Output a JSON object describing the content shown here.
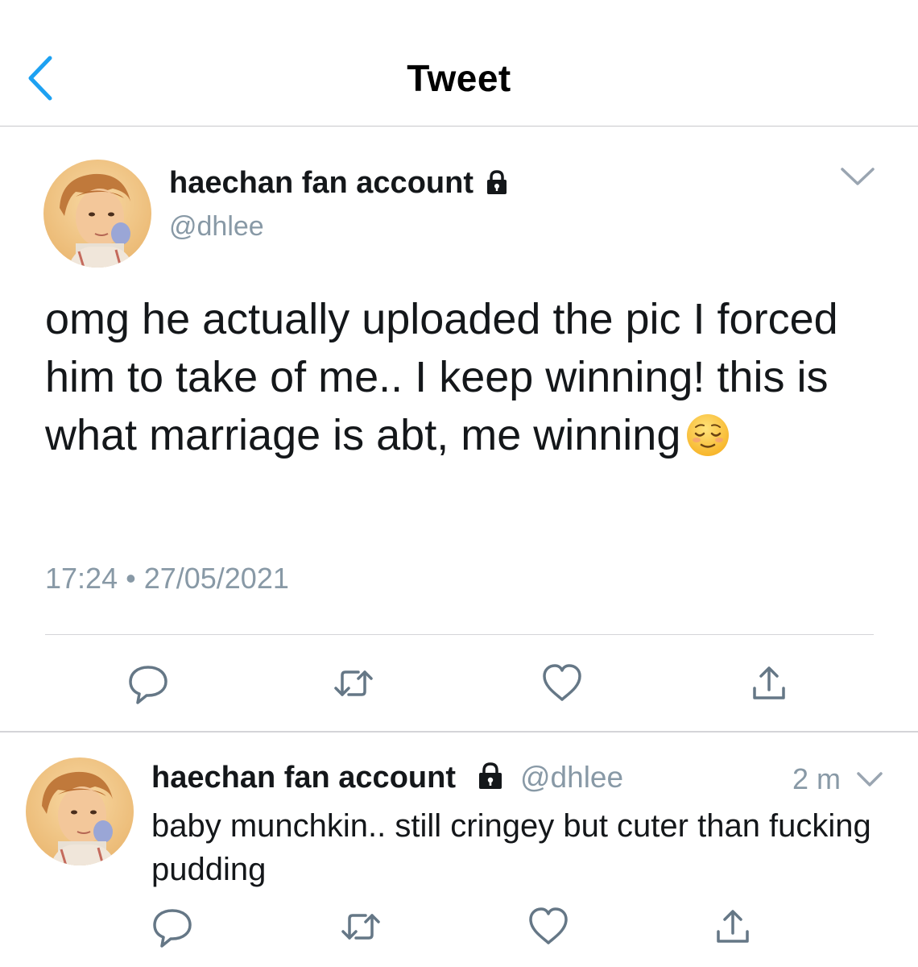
{
  "nav": {
    "title": "Tweet",
    "back_icon": "chevron-left-icon"
  },
  "colors": {
    "accent": "#1da1f2",
    "text_primary": "#14171a",
    "text_secondary": "#8899a6",
    "icon_gray": "#657786",
    "divider": "#d4d4d8"
  },
  "tweet": {
    "author_name": "haechan fan account",
    "author_handle": "@dhlee",
    "protected_icon": "lock-icon",
    "text": "omg he actually uploaded the pic I forced him to take of me.. I keep winning! this is what marriage is abt, me winning",
    "emoji": "relieved-face-emoji",
    "timestamp": "17:24 • 27/05/2021",
    "actions": [
      "reply-icon",
      "retweet-icon",
      "like-icon",
      "share-icon"
    ]
  },
  "reply": {
    "author_name": "haechan fan account",
    "author_handle": "@dhlee",
    "protected_icon": "lock-icon",
    "time_ago": "2 m",
    "text": "baby munchkin.. still cringey but cuter than fucking pudding",
    "actions": [
      "reply-icon",
      "retweet-icon",
      "like-icon",
      "share-icon"
    ]
  }
}
